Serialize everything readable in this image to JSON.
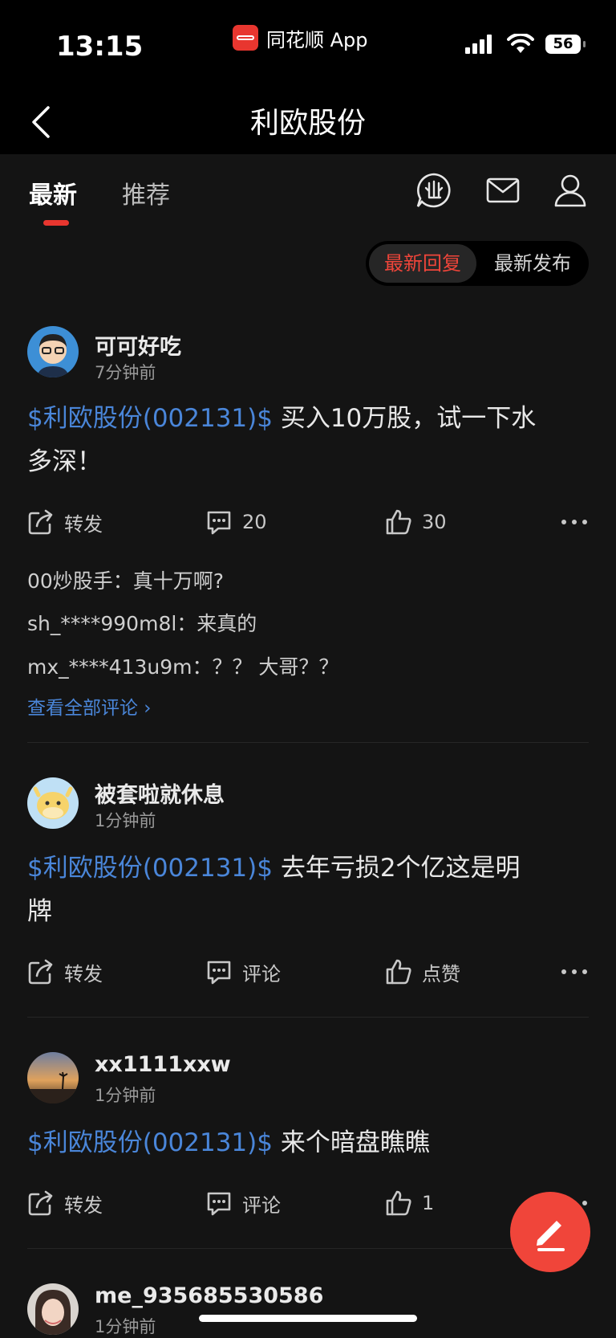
{
  "status_bar": {
    "time": "13:15",
    "app_label": "同花顺 App",
    "battery": "56"
  },
  "nav": {
    "title": "利欧股份"
  },
  "tabs": [
    {
      "label": "最新"
    },
    {
      "label": "推荐"
    }
  ],
  "sort": {
    "active": "最新回复",
    "other": "最新发布"
  },
  "posts": [
    {
      "user": "可可好吃",
      "time": "7分钟前",
      "stock": "$利欧股份(002131)$",
      "text_line1": " 买入10万股，试一下水",
      "text_line2": "多深！",
      "repost": "转发",
      "comments": "20",
      "likes": "30",
      "comment_preview": [
        "00炒股手：真十万啊?",
        "sh_****990m8l：来真的",
        "mx_****413u9m：？？ 大哥？？"
      ],
      "view_all": "查看全部评论 ›"
    },
    {
      "user": "被套啦就休息",
      "time": "1分钟前",
      "stock": "$利欧股份(002131)$",
      "text_line1": " 去年亏损2个亿这是明",
      "text_line2": "牌",
      "repost": "转发",
      "comments": "评论",
      "likes": "点赞"
    },
    {
      "user": "xx1111xxw",
      "time": "1分钟前",
      "stock": "$利欧股份(002131)$",
      "text_line1": " 来个暗盘瞧瞧",
      "repost": "转发",
      "comments": "评论",
      "likes": "1"
    },
    {
      "user": "me_935685530586",
      "time": "1分钟前"
    }
  ],
  "colors": {
    "accent": "#f0453a",
    "link": "#4a86d9",
    "background": "#141414"
  }
}
